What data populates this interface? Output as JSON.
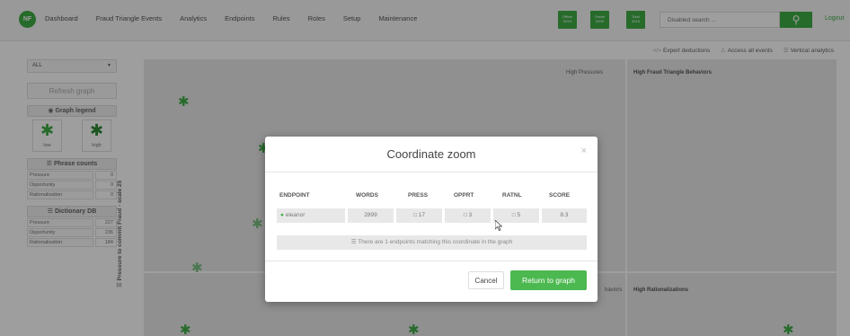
{
  "logo": "NF",
  "nav": [
    "Dashboard",
    "Fraud Triangle Events",
    "Analytics",
    "Endpoints",
    "Rules",
    "Roles",
    "Setup",
    "Maintenance"
  ],
  "counters": [
    {
      "label": "Offline",
      "value": "0015"
    },
    {
      "label": "Online",
      "value": "0000"
    },
    {
      "label": "Total",
      "value": "0015"
    }
  ],
  "search": {
    "placeholder": "Disabled search ..."
  },
  "login": "Logout",
  "subbar": {
    "expert": "Expert deductions",
    "access": "Access all events",
    "vertical": "Vertical analytics"
  },
  "sidebar": {
    "select_value": "ALL",
    "refresh": "Refresh graph",
    "legend_title": "Graph legend",
    "legend_low": "low",
    "legend_high": "high",
    "phrase_title": "Phrase counts",
    "phrase_rows": [
      {
        "k": "Pressure",
        "v": "0"
      },
      {
        "k": "Opportunity",
        "v": "0"
      },
      {
        "k": "Rationalization",
        "v": "0"
      }
    ],
    "dict_title": "Dictionary DB",
    "dict_rows": [
      {
        "k": "Pressure",
        "v": "227"
      },
      {
        "k": "Opportunity",
        "v": "236"
      },
      {
        "k": "Rationalization",
        "v": "184"
      }
    ]
  },
  "graph": {
    "y_axis": "Pressure to commit Fraud - scale 25",
    "q_high_pressures": "High Pressures",
    "q_high_behaviors": "High Fraud Triangle Behaviors",
    "q_behaviors_cut": "haviors",
    "q_high_rationalizations": "High Rationalizations"
  },
  "modal": {
    "title": "Coordinate zoom",
    "close": "×",
    "headers": [
      "ENDPOINT",
      "WORDS",
      "PRESS",
      "OPPRT",
      "RATNL",
      "SCORE"
    ],
    "row": {
      "endpoint": "eleanor",
      "words": "2899",
      "press": "17",
      "opprt": "3",
      "ratnl": "5",
      "score": "8.3"
    },
    "info": "There are 1 endpoints matching this coordinate in the graph",
    "cancel": "Cancel",
    "return": "Return to graph"
  }
}
